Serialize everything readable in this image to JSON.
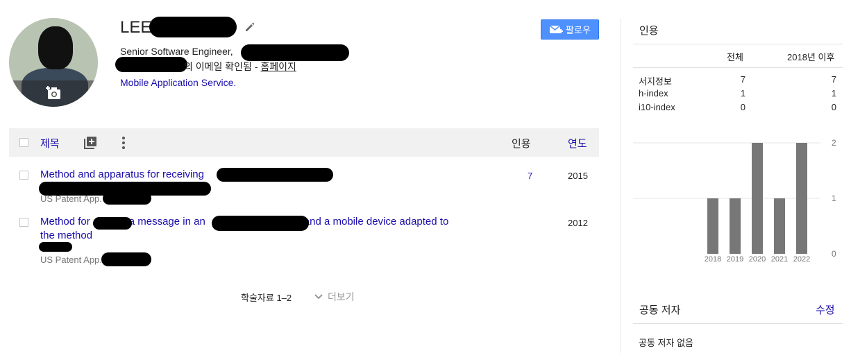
{
  "profile": {
    "name": "LEE",
    "affiliation": "Senior Software Engineer,",
    "email_status": "의 이메일 확인됨 - ",
    "homepage_label": "홈페이지",
    "interest": "Mobile Application Service."
  },
  "follow": {
    "label": "팔로우"
  },
  "table": {
    "header_title": "제목",
    "header_cited": "인용",
    "header_year": "연도",
    "rows": [
      {
        "title": "Method and apparatus for receiving",
        "venue": "US Patent App.",
        "cited": "7",
        "year": "2015"
      },
      {
        "title_part1": "Method for",
        "title_part2": "a message in an",
        "title_part3": "and a mobile device adapted to",
        "title_line2": "the method",
        "venue": "US Patent App.",
        "cited": "",
        "year": "2012"
      }
    ],
    "pager": "학술자료 1–2",
    "more": "더보기"
  },
  "citations": {
    "title": "인용",
    "col_all": "전체",
    "col_since": "2018년 이후",
    "rows": [
      {
        "label": "서지정보",
        "all": "7",
        "since": "7"
      },
      {
        "label": "h-index",
        "all": "1",
        "since": "1"
      },
      {
        "label": "i10-index",
        "all": "0",
        "since": "0"
      }
    ]
  },
  "chart_data": {
    "type": "bar",
    "categories": [
      "2018",
      "2019",
      "2020",
      "2021",
      "2022"
    ],
    "values": [
      1,
      1,
      2,
      1,
      2
    ],
    "yticks": [
      "2",
      "1",
      "0"
    ],
    "ylim": [
      0,
      2
    ],
    "bar_color": "#777777"
  },
  "coauthors": {
    "title": "공동 저자",
    "edit_label": "수정",
    "none_label": "공동 저자 없음"
  }
}
